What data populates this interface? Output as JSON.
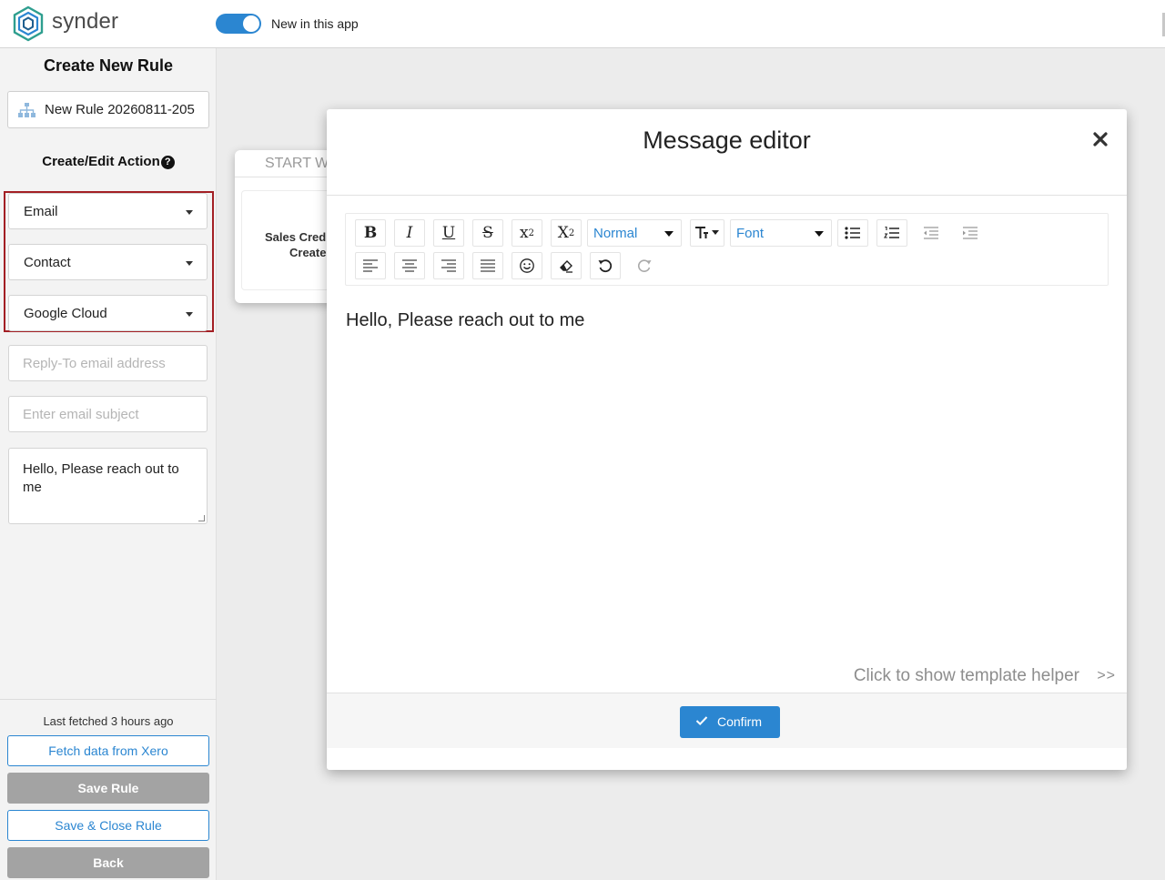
{
  "header": {
    "brand": "synder",
    "toggle_label": "New in this app",
    "toggle_on": true,
    "accent_color": "#2b86d1"
  },
  "sidebar": {
    "title": "Create New Rule",
    "rule_name": "New Rule 20260811-205",
    "action_title": "Create/Edit Action",
    "selects": [
      "Email",
      "Contact",
      "Google Cloud"
    ],
    "reply_to_placeholder": "Reply-To email address",
    "subject_placeholder": "Enter email subject",
    "message": "Hello, Please reach out to me",
    "last_fetched": "Last fetched 3 hours ago",
    "fetch_button": "Fetch data from Xero",
    "save_button": "Save Rule",
    "save_close_button": "Save & Close Rule",
    "back_button": "Back",
    "highlight_color": "#a31f24"
  },
  "flow": {
    "header": "START W",
    "line1": "Sales Credit",
    "line2": "Create"
  },
  "modal": {
    "title": "Message editor",
    "toolbar": {
      "bold": "B",
      "italic": "I",
      "underline": "U",
      "strike": "S",
      "superscript_base": "x",
      "superscript_exp": "2",
      "subscript_base": "X",
      "subscript_sub": "2",
      "size_select": "Normal",
      "font_select": "Font"
    },
    "content": "Hello, Please reach out to me",
    "helper": "Click to show template helper",
    "helper_arrow": ">>",
    "confirm": "Confirm"
  }
}
